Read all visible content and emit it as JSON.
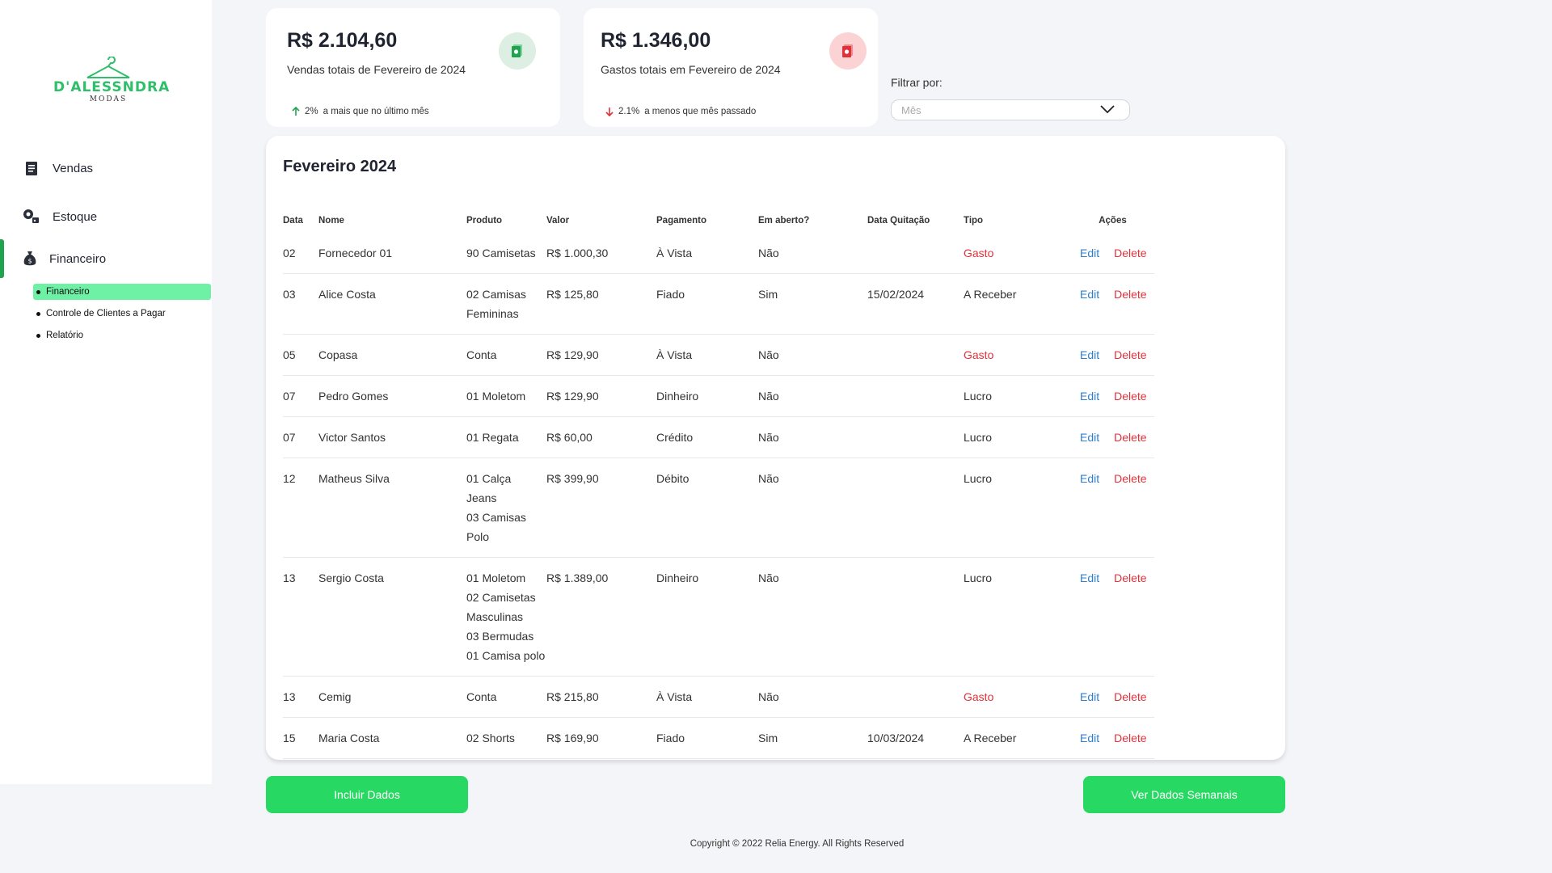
{
  "brand": {
    "name": "D'ALESSNDRA",
    "sub": "MODAS",
    "color": "#2fbf6b"
  },
  "sidebar": {
    "items": [
      {
        "label": "Vendas",
        "icon": "receipt-icon"
      },
      {
        "label": "Estoque",
        "icon": "stock-icon"
      },
      {
        "label": "Financeiro",
        "icon": "money-bag-icon",
        "active": true
      }
    ],
    "subitems": [
      {
        "label": "Financeiro",
        "selected": true
      },
      {
        "label": "Controle de Clientes a Pagar"
      },
      {
        "label": "Relatório"
      }
    ]
  },
  "cards": {
    "sales": {
      "amount": "R$ 2.104,60",
      "subtitle": "Vendas totais de Fevereiro de 2024",
      "pct": "2%",
      "trend_text": "a mais que no último mês",
      "trend_direction": "up",
      "color": "#1fa34f"
    },
    "expenses": {
      "amount": "R$ 1.346,00",
      "subtitle": "Gastos totais em Fevereiro de 2024",
      "pct": "2.1%",
      "trend_text": "a menos que mês passado",
      "trend_direction": "down",
      "color": "#e0313a"
    }
  },
  "filter": {
    "label": "Filtrar por:",
    "placeholder": "Mês"
  },
  "table": {
    "title": "Fevereiro 2024",
    "headers": {
      "data": "Data",
      "nome": "Nome",
      "produto": "Produto",
      "valor": "Valor",
      "pagamento": "Pagamento",
      "aberto": "Em aberto?",
      "quitacao": "Data Quitação",
      "tipo": "Tipo",
      "acoes": "Ações"
    },
    "edit_label": "Edit",
    "delete_label": "Delete",
    "rows": [
      {
        "data": "02",
        "nome": "Fornecedor 01",
        "produto": [
          "90 Camisetas"
        ],
        "valor": "R$ 1.000,30",
        "pagamento": "À Vista",
        "aberto": "Não",
        "quitacao": "",
        "tipo": "Gasto"
      },
      {
        "data": "03",
        "nome": "Alice Costa",
        "produto": [
          "02 Camisas",
          "Femininas"
        ],
        "valor": "R$ 125,80",
        "pagamento": "Fiado",
        "aberto": "Sim",
        "quitacao": "15/02/2024",
        "tipo": "A Receber"
      },
      {
        "data": "05",
        "nome": "Copasa",
        "produto": [
          "Conta"
        ],
        "valor": "R$ 129,90",
        "pagamento": "À Vista",
        "aberto": "Não",
        "quitacao": "",
        "tipo": "Gasto"
      },
      {
        "data": "07",
        "nome": "Pedro Gomes",
        "produto": [
          "01 Moletom"
        ],
        "valor": "R$ 129,90",
        "pagamento": "Dinheiro",
        "aberto": "Não",
        "quitacao": "",
        "tipo": "Lucro"
      },
      {
        "data": "07",
        "nome": "Victor Santos",
        "produto": [
          "01 Regata"
        ],
        "valor": "R$ 60,00",
        "pagamento": "Crédito",
        "aberto": "Não",
        "quitacao": "",
        "tipo": "Lucro"
      },
      {
        "data": "12",
        "nome": "Matheus Silva",
        "produto": [
          "01 Calça",
          "Jeans",
          "03 Camisas",
          "Polo"
        ],
        "valor": "R$ 399,90",
        "pagamento": "Débito",
        "aberto": "Não",
        "quitacao": "",
        "tipo": "Lucro"
      },
      {
        "data": "13",
        "nome": "Sergio Costa",
        "produto": [
          "01 Moletom",
          "02 Camisetas",
          "Masculinas",
          "03 Bermudas",
          "01 Camisa polo"
        ],
        "valor": "R$ 1.389,00",
        "pagamento": "Dinheiro",
        "aberto": "Não",
        "quitacao": "",
        "tipo": "Lucro"
      },
      {
        "data": "13",
        "nome": "Cemig",
        "produto": [
          "Conta"
        ],
        "valor": "R$ 215,80",
        "pagamento": "À Vista",
        "aberto": "Não",
        "quitacao": "",
        "tipo": "Gasto"
      },
      {
        "data": "15",
        "nome": "Maria Costa",
        "produto": [
          "02 Shorts"
        ],
        "valor": "R$ 169,90",
        "pagamento": "Fiado",
        "aberto": "Sim",
        "quitacao": "10/03/2024",
        "tipo": "A Receber"
      }
    ]
  },
  "buttons": {
    "include": "Incluir Dados",
    "weekly": "Ver Dados Semanais"
  },
  "footer": "Copyright  © 2022 Relia Energy. All Rights Reserved"
}
